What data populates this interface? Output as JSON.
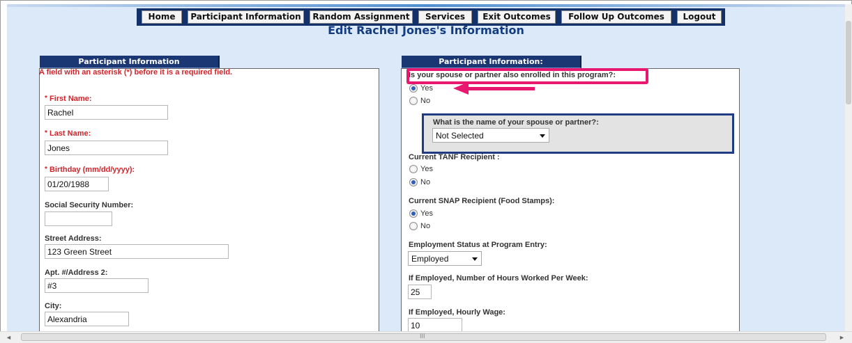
{
  "nav": {
    "items": [
      "Home",
      "Participant Information",
      "Random Assignment",
      "Services",
      "Exit Outcomes",
      "Follow Up Outcomes",
      "Logout"
    ]
  },
  "page_title": "Edit Rachel Jones's Information",
  "left_panel": {
    "tab_label": "Participant Information",
    "required_note": "A field with an asterisk (*) before it is a required field.",
    "fields": {
      "first_name": {
        "label": "First Name:",
        "value": "Rachel"
      },
      "last_name": {
        "label": "Last Name:",
        "value": "Jones"
      },
      "birthday": {
        "label": "Birthday (mm/dd/yyyy):",
        "value": "01/20/1988"
      },
      "ssn": {
        "label": "Social Security Number:",
        "value": ""
      },
      "street": {
        "label": "Street Address:",
        "value": "123 Green Street"
      },
      "apt": {
        "label": "Apt. #/Address 2:",
        "value": "#3"
      },
      "city": {
        "label": "City:",
        "value": "Alexandria"
      }
    },
    "asterisk": "*"
  },
  "right_panel": {
    "tab_label": "Participant Information:",
    "spouse_question": "Is your spouse or partner also enrolled in this program?:",
    "spouse_options": {
      "yes": "Yes",
      "no": "No",
      "selected": "Yes"
    },
    "spouse_name_label": "What is the name of your spouse or partner?:",
    "spouse_name_value": "Not Selected",
    "tanf_label": "Current TANF Recipient :",
    "tanf_options": {
      "yes": "Yes",
      "no": "No",
      "selected": "No"
    },
    "snap_label": "Current SNAP Recipient (Food Stamps):",
    "snap_options": {
      "yes": "Yes",
      "no": "No",
      "selected": "Yes"
    },
    "employment_label": "Employment Status at Program Entry:",
    "employment_value": "Employed",
    "hours_label": "If Employed, Number of Hours Worked Per Week:",
    "hours_value": "25",
    "wage_label": "If Employed, Hourly Wage:",
    "wage_value": "10"
  },
  "scrollbar": {
    "grip": "III",
    "left_arrow": "◄",
    "right_arrow": "►"
  },
  "colors": {
    "nav_bg": "#12306a",
    "accent_blue": "#1a3673",
    "required_red": "#d2232a",
    "highlight_pink": "#e8176f",
    "page_bg": "#dce9f8"
  }
}
